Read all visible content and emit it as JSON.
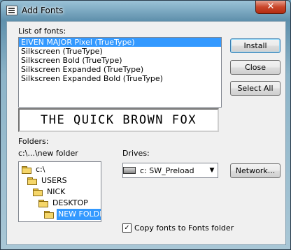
{
  "window": {
    "title": "Add Fonts",
    "close_glyph": "✕"
  },
  "fonts_label": "List of fonts:",
  "fonts": [
    {
      "name": "EIVEN MAJOR  Pixel (TrueType)",
      "selected": true
    },
    {
      "name": "Silkscreen (TrueType)"
    },
    {
      "name": "Silkscreen Bold (TrueType)"
    },
    {
      "name": "Silkscreen Expanded (TrueType)"
    },
    {
      "name": "Silkscreen Expanded Bold (TrueType)"
    }
  ],
  "preview": "THE QUICK BROWN FOX",
  "buttons": {
    "install": "Install",
    "close": "Close",
    "select_all": "Select All",
    "network": "Network..."
  },
  "folders_label": "Folders:",
  "current_path": "c:\\...\\new folder",
  "folders": [
    {
      "name": "c:\\",
      "depth": 0
    },
    {
      "name": "USERS",
      "depth": 1
    },
    {
      "name": "NICK",
      "depth": 2
    },
    {
      "name": "DESKTOP",
      "depth": 3
    },
    {
      "name": "NEW FOLDER",
      "depth": 4,
      "selected": true
    }
  ],
  "drives_label": "Drives:",
  "drive": {
    "value": "c: SW_Preload",
    "arrow": "▼"
  },
  "copy_checkbox": {
    "label": "Copy fonts to Fonts folder",
    "checked": true,
    "mark": "✓"
  },
  "colors": {
    "selection": "#3399ff",
    "close_button": "#c9462a"
  }
}
